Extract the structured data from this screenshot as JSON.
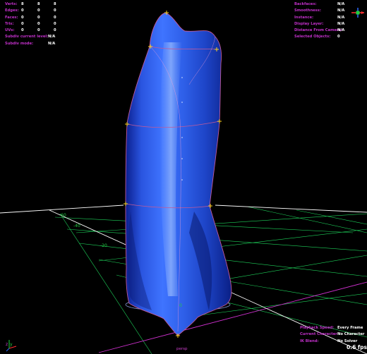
{
  "heads_up_left": {
    "rows": [
      {
        "label": "Verts:",
        "values": [
          "8",
          "8",
          "8"
        ]
      },
      {
        "label": "Edges:",
        "values": [
          "0",
          "0",
          "0"
        ]
      },
      {
        "label": "Faces:",
        "values": [
          "0",
          "0",
          "0"
        ]
      },
      {
        "label": "Tris:",
        "values": [
          "0",
          "0",
          "0"
        ]
      },
      {
        "label": "UVs:",
        "values": [
          "0",
          "0",
          "0"
        ]
      }
    ],
    "subdiv_level_label": "Subdiv current level:",
    "subdiv_level_value": "N/A",
    "subdiv_mode_label": "Subdiv mode:",
    "subdiv_mode_value": "N/A"
  },
  "heads_up_right": {
    "rows": [
      {
        "label": "Backfaces:",
        "value": "N/A"
      },
      {
        "label": "Smoothness:",
        "value": "N/A"
      },
      {
        "label": "Instance:",
        "value": "N/A"
      },
      {
        "label": "Display Layer:",
        "value": "N/A"
      },
      {
        "label": "Distance From Camera:",
        "value": "N/A"
      },
      {
        "label": "Selected Objects:",
        "value": "0"
      }
    ]
  },
  "heads_up_bottom": {
    "rows": [
      {
        "label": "Playback Speed:",
        "value": "Every Frame"
      },
      {
        "label": "Current Character:",
        "value": "No Character"
      },
      {
        "label": "IK Blend:",
        "value": "No Solver"
      }
    ],
    "fps": "0.6 fps"
  },
  "camera": "persp",
  "grid_labels": [
    "-60",
    "-40",
    "-20",
    "0"
  ],
  "colors": {
    "background": "#000000",
    "hud_label": "#c030c8",
    "hud_value": "#ffffff",
    "grid_main": "#ffffff",
    "grid_green": "#1ed25a",
    "grid_magenta": "#d030d0",
    "surface_blue": "#2e5fe8",
    "curve_color": "#c05a9a"
  },
  "icons": {
    "axis_gizmo": "axis-gizmo-icon",
    "view_cube": "view-cube-icon"
  }
}
